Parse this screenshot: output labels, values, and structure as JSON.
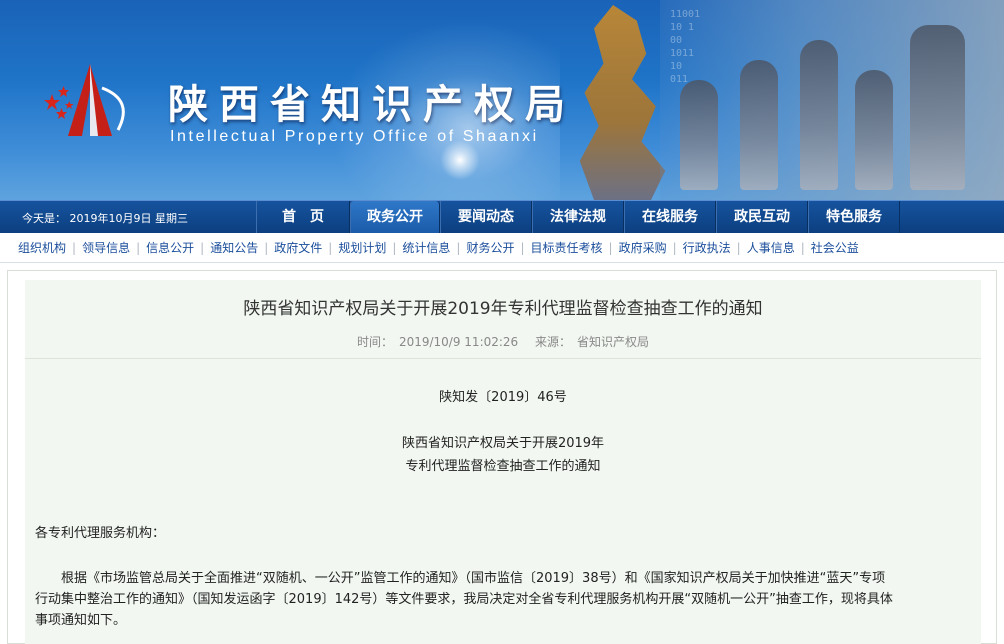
{
  "site": {
    "title": "陕西省知识产权局",
    "subtitle": "Intellectual Property Office of Shaanxi",
    "banner_digits": [
      "11001",
      "10 1",
      "00",
      "1011",
      "10",
      "011"
    ]
  },
  "navbar": {
    "today": "今天是： 2019年10月9日 星期三",
    "items": [
      {
        "label": "首　页"
      },
      {
        "label": "政务公开",
        "active": true
      },
      {
        "label": "要闻动态"
      },
      {
        "label": "法律法规"
      },
      {
        "label": "在线服务"
      },
      {
        "label": "政民互动"
      },
      {
        "label": "特色服务"
      }
    ]
  },
  "subnav": {
    "items": [
      "组织机构",
      "领导信息",
      "信息公开",
      "通知公告",
      "政府文件",
      "规划计划",
      "统计信息",
      "财务公开",
      "目标责任考核",
      "政府采购",
      "行政执法",
      "人事信息",
      "社会公益"
    ]
  },
  "article": {
    "title": "陕西省知识产权局关于开展2019年专利代理监督检查抽查工作的通知",
    "time_label": "时间：",
    "time_value": "2019/10/9 11:02:26",
    "source_label": "来源：",
    "source_value": "省知识产权局",
    "doc_number": "陕知发〔2019〕46号",
    "heading_line1": "陕西省知识产权局关于开展2019年",
    "heading_line2": "专利代理监督检查抽查工作的通知",
    "salutation": "各专利代理服务机构：",
    "body_line1": "根据《市场监管总局关于全面推进“双随机、一公开”监管工作的通知》（国市监信〔2019〕38号）和《国家知识产权局关于加快推进“蓝天”专项",
    "body_line2": "行动集中整治工作的通知》（国知发运函字〔2019〕142号）等文件要求，我局决定对全省专利代理服务机构开展“双随机一公开”抽查工作，现将具体",
    "body_line3": "事项通知如下。"
  },
  "colors": {
    "banner_blue": "#1f74c8",
    "nav_blue": "#0c3f80",
    "link_blue": "#1b4e9b",
    "article_bg": "#f2f8f1",
    "logo_red": "#d9261c"
  }
}
